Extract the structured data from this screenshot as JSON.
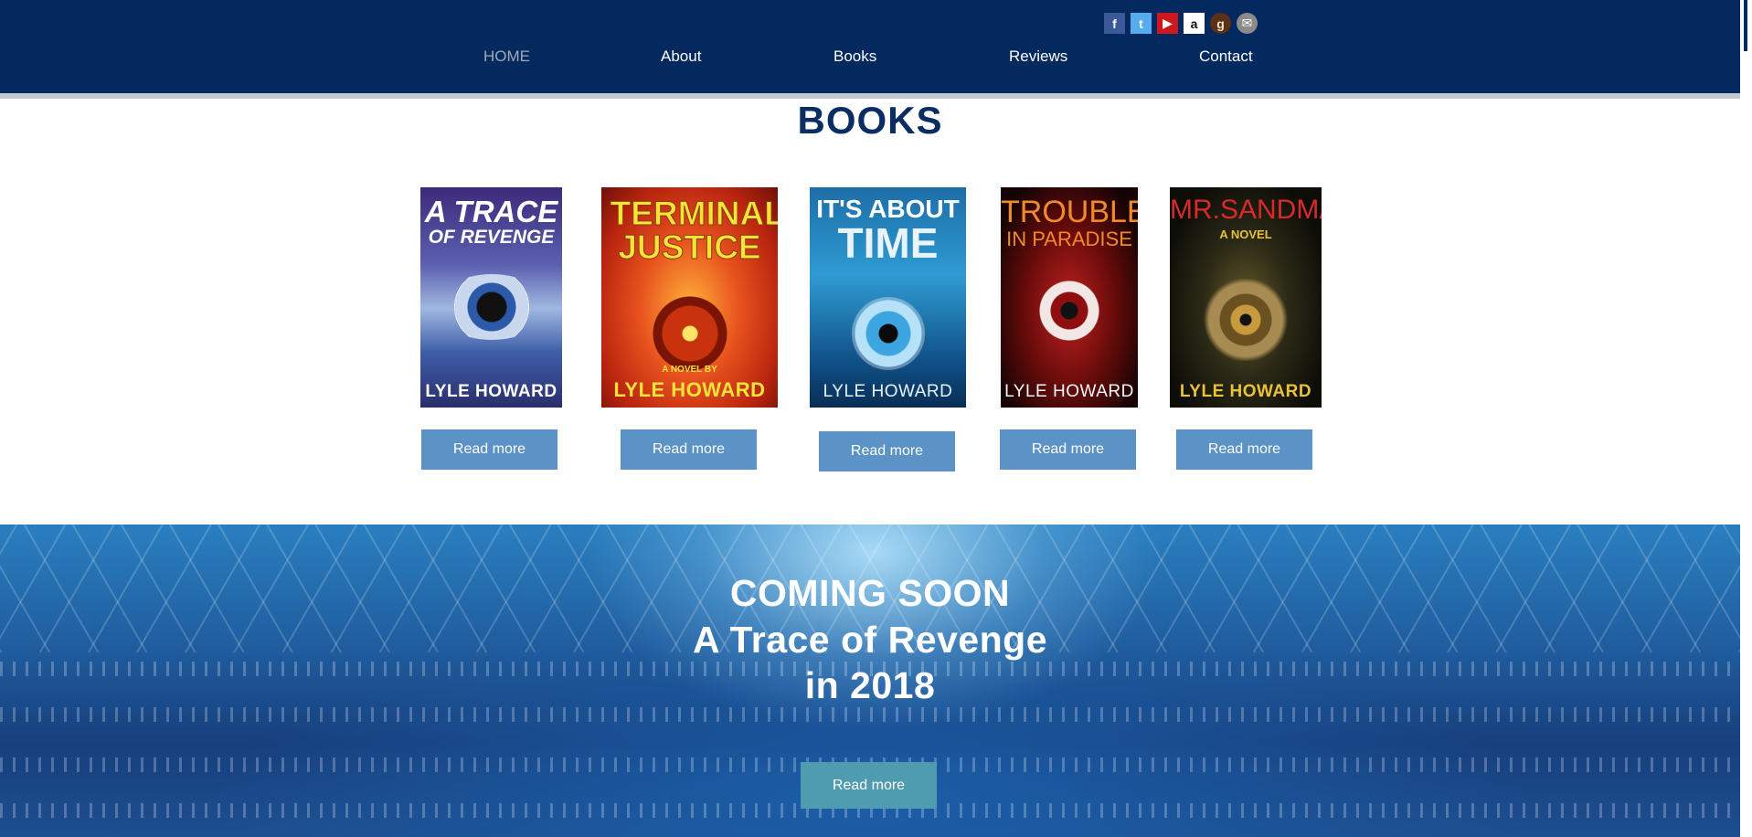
{
  "social": [
    {
      "name": "facebook-icon",
      "glyph": "f"
    },
    {
      "name": "twitter-icon",
      "glyph": "t"
    },
    {
      "name": "youtube-icon",
      "glyph": "▶"
    },
    {
      "name": "amazon-icon",
      "glyph": "a"
    },
    {
      "name": "goodreads-icon",
      "glyph": "g"
    },
    {
      "name": "email-icon",
      "glyph": "✉"
    }
  ],
  "nav": {
    "home": "HOME",
    "about": "About",
    "books": "Books",
    "reviews": "Reviews",
    "contact": "Contact"
  },
  "books_section": {
    "title": "BOOKS",
    "covers": [
      {
        "title": "A TRACE",
        "subtitle": "OF REVENGE",
        "author": "LYLE HOWARD",
        "button": "Read more"
      },
      {
        "title": "TERMINAL JUSTICE",
        "subtitle": "A NOVEL BY",
        "author": "LYLE HOWARD",
        "button": "Read more"
      },
      {
        "title": "IT'S ABOUT",
        "subtitle": "TIME",
        "author": "LYLE HOWARD",
        "button": "Read more"
      },
      {
        "title": "TROUBLE",
        "subtitle": "IN PARADISE",
        "author": "LYLE HOWARD",
        "button": "Read more"
      },
      {
        "title": "MR.SANDMAN",
        "subtitle": "A NOVEL",
        "author": "LYLE HOWARD",
        "button": "Read more"
      }
    ]
  },
  "banner": {
    "line1": "COMING SOON",
    "line2": "A Trace of Revenge",
    "line3": "in 2018",
    "button": "Read more"
  },
  "colors": {
    "header": "#04295e",
    "button": "#5b93c7",
    "banner_button": "#4f9bb0",
    "title": "#0a2e63"
  }
}
